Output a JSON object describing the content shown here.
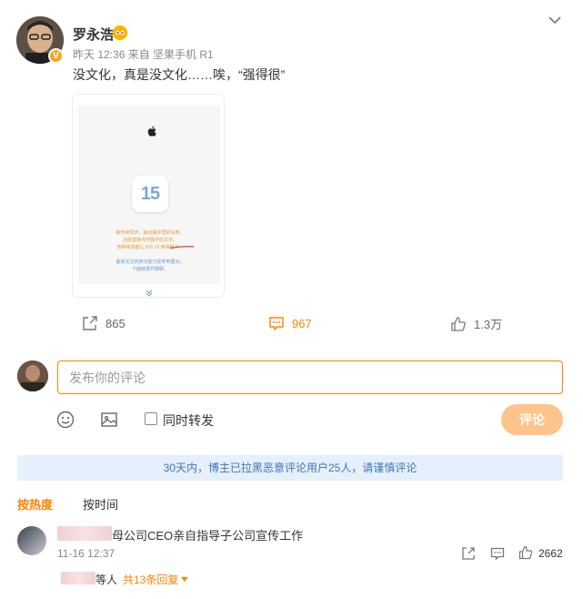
{
  "post": {
    "author_name": "罗永浩",
    "meta": "昨天 12:36  来自 坚果手机 R1",
    "text": "没文化，真是没文化……唉，“强得很”",
    "image": {
      "tile_number": "15",
      "orange_text": [
        "聊天神同步，抽出抽手里的东西，",
        "还能直接点开图中的文字。",
        "各种体验都让 iOS 15 亲得很了。"
      ],
      "blue_text": [
        "备受关注的新功能已经拿到重点，",
        "下面就展开聊聊。"
      ]
    },
    "actions": {
      "repost_count": "865",
      "comment_count": "967",
      "like_count": "1.3万"
    }
  },
  "composer": {
    "placeholder": "发布你的评论",
    "repost_label": "同时转发",
    "submit_label": "评论"
  },
  "notice": "30天内，博主已拉黑恶意评论用户25人，请谨慎评论",
  "sort_tabs": [
    {
      "label": "按热度",
      "active": true
    },
    {
      "label": "按时间",
      "active": false
    }
  ],
  "comments": [
    {
      "text": "母公司CEO亲自指导子公司宣传工作",
      "time": "11-16 12:37",
      "like_count": "2662",
      "reply_who": "等人",
      "reply_count": "共13条回复"
    }
  ],
  "colors": {
    "accent": "#ff8200",
    "notice_bg": "#e6f0fb",
    "notice_text": "#3b76b8",
    "submit_disabled": "#ffc48a"
  },
  "icons": [
    "chevron-down-icon",
    "vip-icon",
    "apple-logo-icon",
    "share-icon",
    "comment-icon",
    "like-icon",
    "emoji-icon",
    "image-icon"
  ]
}
